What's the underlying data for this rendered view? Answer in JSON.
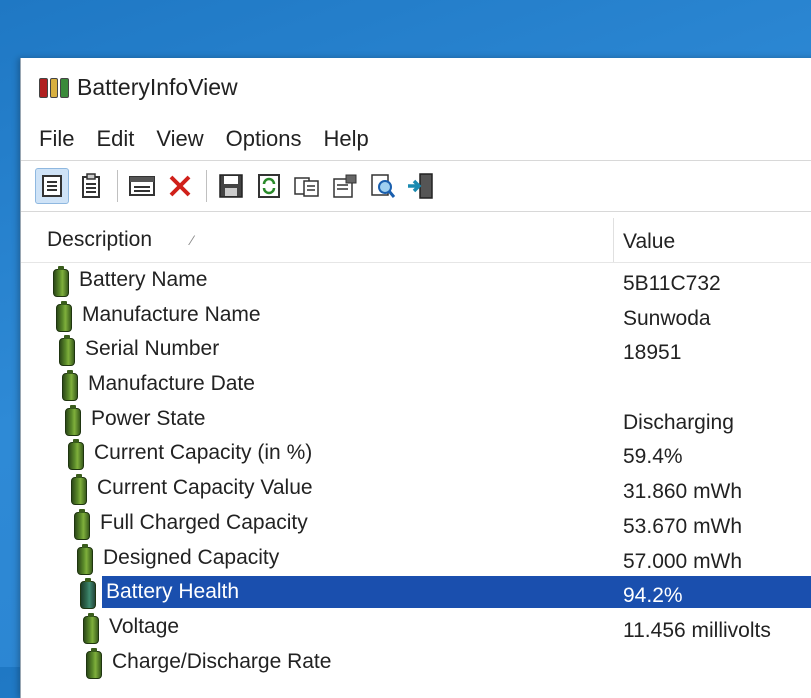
{
  "window": {
    "title": "BatteryInfoView"
  },
  "menu": [
    "File",
    "Edit",
    "View",
    "Options",
    "Help"
  ],
  "toolbar": {
    "icons": [
      "properties-icon",
      "copy-report-icon",
      "html-report-icon",
      "delete-icon",
      "save-icon",
      "refresh-icon",
      "copy-icon",
      "options-icon",
      "find-icon",
      "exit-icon"
    ]
  },
  "columns": {
    "description": "Description",
    "value": "Value"
  },
  "rows": [
    {
      "label": "Battery Name",
      "value": "5B11C732"
    },
    {
      "label": "Manufacture Name",
      "value": "Sunwoda"
    },
    {
      "label": "Serial Number",
      "value": "18951"
    },
    {
      "label": "Manufacture Date",
      "value": ""
    },
    {
      "label": "Power State",
      "value": "Discharging"
    },
    {
      "label": "Current Capacity (in %)",
      "value": "59.4%"
    },
    {
      "label": "Current Capacity Value",
      "value": "31.860 mWh"
    },
    {
      "label": "Full Charged Capacity",
      "value": "53.670 mWh"
    },
    {
      "label": "Designed Capacity",
      "value": "57.000 mWh"
    },
    {
      "label": "Battery Health",
      "value": "94.2%",
      "selected": true
    },
    {
      "label": "Voltage",
      "value": "11.456 millivolts"
    },
    {
      "label": "Charge/Discharge Rate",
      "value": ""
    }
  ],
  "colors": {
    "selection": "#1a4fae",
    "desktop": "#2a82cf"
  }
}
